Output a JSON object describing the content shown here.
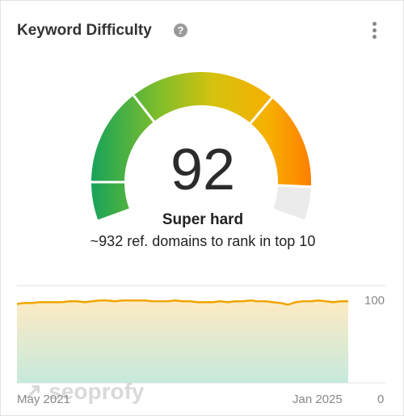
{
  "header": {
    "title": "Keyword Difficulty",
    "help_icon": "question-circle-icon",
    "menu_icon": "more-vertical-icon"
  },
  "gauge": {
    "value": 92,
    "value_text": "92",
    "max": 100,
    "label": "Super hard",
    "description": "~932 ref. domains to rank in top 10",
    "colors": {
      "green": "#1ea35b",
      "yellow": "#c8c81a",
      "orange": "#ff8000",
      "empty": "#ebebeb"
    }
  },
  "watermark": "seoprofy",
  "chart_data": {
    "type": "area",
    "x_labels": [
      "May 2021",
      "Jan 2025"
    ],
    "y_ticks": [
      "100",
      "0"
    ],
    "ylim": [
      0,
      100
    ],
    "grid": true,
    "line_color": "#f0a500",
    "values": [
      92,
      93,
      93,
      94,
      94,
      94,
      94,
      95,
      95,
      94,
      95,
      96,
      96,
      95,
      96,
      96,
      96,
      96,
      95,
      95,
      95,
      96,
      95,
      95,
      94,
      94,
      94,
      95,
      94,
      95,
      95,
      96,
      95,
      95,
      94,
      93,
      91,
      94,
      95,
      95,
      96,
      95,
      94,
      95,
      95
    ]
  }
}
